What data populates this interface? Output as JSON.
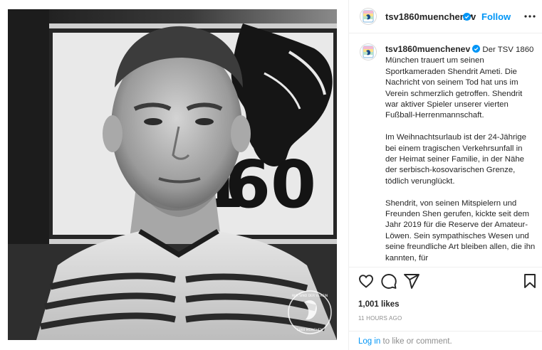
{
  "post": {
    "username": "tsv1860muenchenev",
    "dot": "•",
    "follow_label": "Follow",
    "caption_paragraphs": [
      "Der TSV 1860 München trauert um seinen Sportkameraden Shendrit Ameti. Die Nachricht von seinem Tod hat uns im Verein schmerzlich getroffen. Shendrit war aktiver Spieler unserer vierten Fußball-Herrenmannschaft.",
      "Im Weihnachtsurlaub ist der 24-Jährige bei einem tragischen Verkehrsunfall in der Heimat seiner Familie, in der Nähe der serbisch-kosovarischen Grenze, tödlich verunglückt.",
      "Shendrit, von seinen Mitspielern und Freunden Shen gerufen, kickte seit dem Jahr 2019 für die Reserve der Amateur-Löwen. Sein sympathisches Wesen und seine freundliche Art bleiben allen, die ihn kannten, für"
    ],
    "likes": "1,001 likes",
    "timestamp": "11 HOURS AGO",
    "login_link": "Log in",
    "login_rest": " to like or comment."
  },
  "photo": {
    "sign_number": "60",
    "sign_first_digit": "1",
    "watermark_top": "WIR SIND DER VEREIN",
    "watermark_bottom": "1860 MÜNCHEN"
  },
  "colors": {
    "accent": "#0095f6",
    "verified": "#0095f6",
    "text": "#262626",
    "muted": "#8e8e8e",
    "border": "#efefef"
  },
  "icons": [
    "verified-badge-icon",
    "more-options-icon",
    "heart-icon",
    "comment-icon",
    "share-icon",
    "bookmark-icon",
    "club-logo-icon"
  ]
}
